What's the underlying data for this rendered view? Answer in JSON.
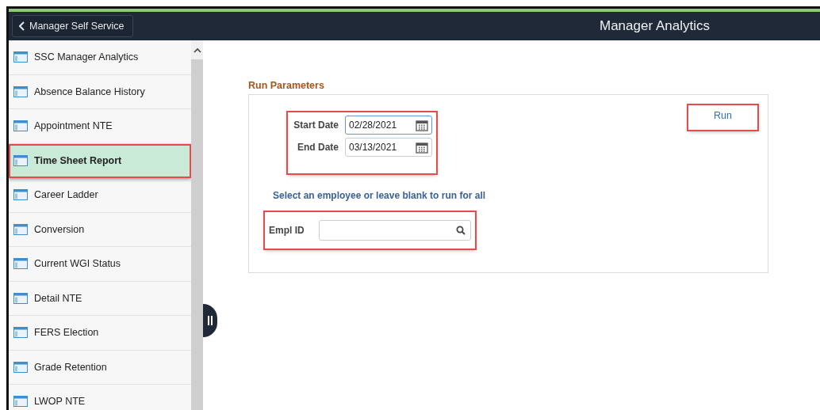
{
  "header": {
    "back_button": "Manager Self Service",
    "title": "Manager Analytics"
  },
  "sidebar": {
    "items": [
      {
        "label": "SSC Manager Analytics",
        "selected": false,
        "highlighted": false
      },
      {
        "label": "Absence Balance History",
        "selected": false,
        "highlighted": false
      },
      {
        "label": "Appointment NTE",
        "selected": false,
        "highlighted": false
      },
      {
        "label": "Time Sheet Report",
        "selected": true,
        "highlighted": true
      },
      {
        "label": "Career Ladder",
        "selected": false,
        "highlighted": false
      },
      {
        "label": "Conversion",
        "selected": false,
        "highlighted": false
      },
      {
        "label": "Current WGI Status",
        "selected": false,
        "highlighted": false
      },
      {
        "label": "Detail NTE",
        "selected": false,
        "highlighted": false
      },
      {
        "label": "FERS Election",
        "selected": false,
        "highlighted": false
      },
      {
        "label": "Grade Retention",
        "selected": false,
        "highlighted": false
      },
      {
        "label": "LWOP NTE",
        "selected": false,
        "highlighted": false
      }
    ]
  },
  "run_parameters": {
    "title": "Run Parameters",
    "dates": {
      "highlighted": true,
      "fields": [
        {
          "label": "Start Date",
          "value": "02/28/2021",
          "focused": true
        },
        {
          "label": "End Date",
          "value": "03/13/2021",
          "focused": false
        }
      ]
    },
    "run_button": {
      "label": "Run",
      "highlighted": true
    },
    "note": "Select an employee or leave blank to run for all",
    "employee": {
      "label": "Empl ID",
      "highlighted": true
    }
  }
}
